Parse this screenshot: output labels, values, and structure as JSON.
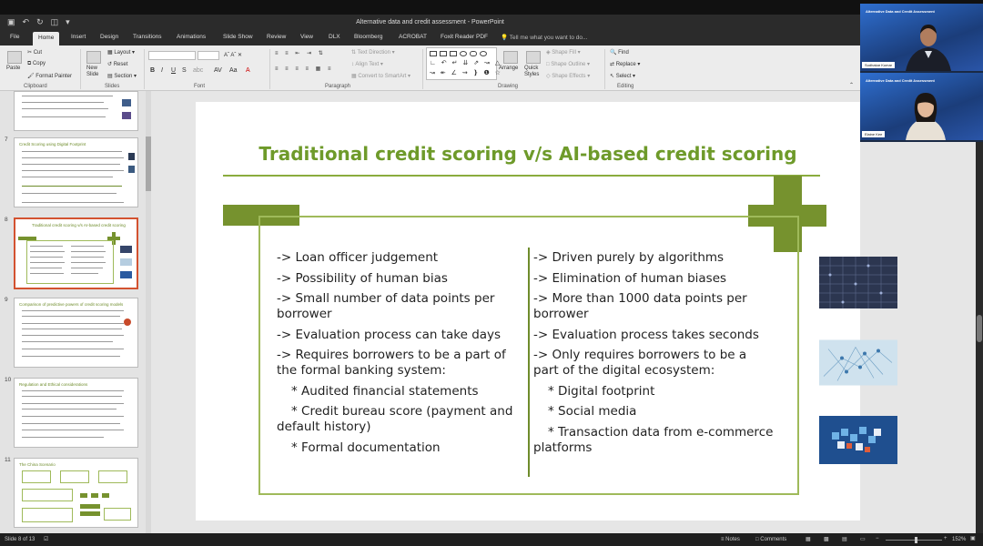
{
  "window": {
    "title": "Alternative data and credit assessment - PowerPoint"
  },
  "menu": {
    "tabs": [
      "File",
      "Home",
      "Insert",
      "Design",
      "Transitions",
      "Animations",
      "Slide Show",
      "Review",
      "View",
      "DLX",
      "Bloomberg",
      "ACROBAT",
      "Foxit Reader PDF"
    ],
    "active": "Home",
    "tell_me": "Tell me what you want to do..."
  },
  "ribbon": {
    "clipboard": {
      "paste": "Paste",
      "cut": "Cut",
      "copy": "Copy",
      "format_painter": "Format Painter",
      "label": "Clipboard"
    },
    "slides": {
      "new_slide": "New Slide",
      "layout": "Layout",
      "reset": "Reset",
      "section": "Section",
      "label": "Slides"
    },
    "font": {
      "label": "Font"
    },
    "paragraph": {
      "text_direction": "Text Direction",
      "align_text": "Align Text",
      "convert": "Convert to SmartArt",
      "label": "Paragraph"
    },
    "drawing": {
      "arrange": "Arrange",
      "quick_styles": "Quick Styles",
      "shape_fill": "Shape Fill",
      "shape_outline": "Shape Outline",
      "shape_effects": "Shape Effects",
      "label": "Drawing"
    },
    "editing": {
      "find": "Find",
      "replace": "Replace",
      "select": "Select",
      "label": "Editing"
    }
  },
  "thumbnails": [
    {
      "num": "7",
      "title": "Credit Scoring using Digital Footprint"
    },
    {
      "num": "8",
      "title": "Traditional credit scoring v/s AI-based credit scoring"
    },
    {
      "num": "9",
      "title": "Comparison of predictive powers of credit scoring models"
    },
    {
      "num": "10",
      "title": "Regulation and Ethical considerations"
    },
    {
      "num": "11",
      "title": "The China Scenario"
    }
  ],
  "slide": {
    "title": "Traditional credit scoring v/s AI-based credit scoring",
    "left": [
      {
        "text": "-> Loan officer judgement",
        "sub": false
      },
      {
        "text": "-> Possibility of human bias",
        "sub": false
      },
      {
        "text": "-> Small number of data points per borrower",
        "sub": false
      },
      {
        "text": "-> Evaluation process can take days",
        "sub": false
      },
      {
        "text": "-> Requires borrowers to be a part of the formal banking system:",
        "sub": false
      },
      {
        "text": "* Audited financial statements",
        "sub": true
      },
      {
        "text": "* Credit bureau score (payment and default history)",
        "sub": true
      },
      {
        "text": "* Formal documentation",
        "sub": true
      }
    ],
    "right": [
      {
        "text": "-> Driven purely by algorithms",
        "sub": false
      },
      {
        "text": "-> Elimination of human biases",
        "sub": false
      },
      {
        "text": "-> More than 1000 data points per borrower",
        "sub": false
      },
      {
        "text": "-> Evaluation process takes seconds",
        "sub": false
      },
      {
        "text": "-> Only requires borrowers to be a part of the digital ecosystem:",
        "sub": false
      },
      {
        "text": "* Digital footprint",
        "sub": true
      },
      {
        "text": "* Social media",
        "sub": true
      },
      {
        "text": "* Transaction data from e-commerce platforms",
        "sub": true
      }
    ]
  },
  "video": {
    "header": "Alternative Data and Credit Assessment",
    "participants": [
      {
        "name": "Sudhakar Kumar"
      },
      {
        "name": "Elaine Kee"
      }
    ]
  },
  "status": {
    "slide_info": "Slide 8 of 13",
    "notes": "Notes",
    "comments": "Comments",
    "zoom": "152%"
  }
}
